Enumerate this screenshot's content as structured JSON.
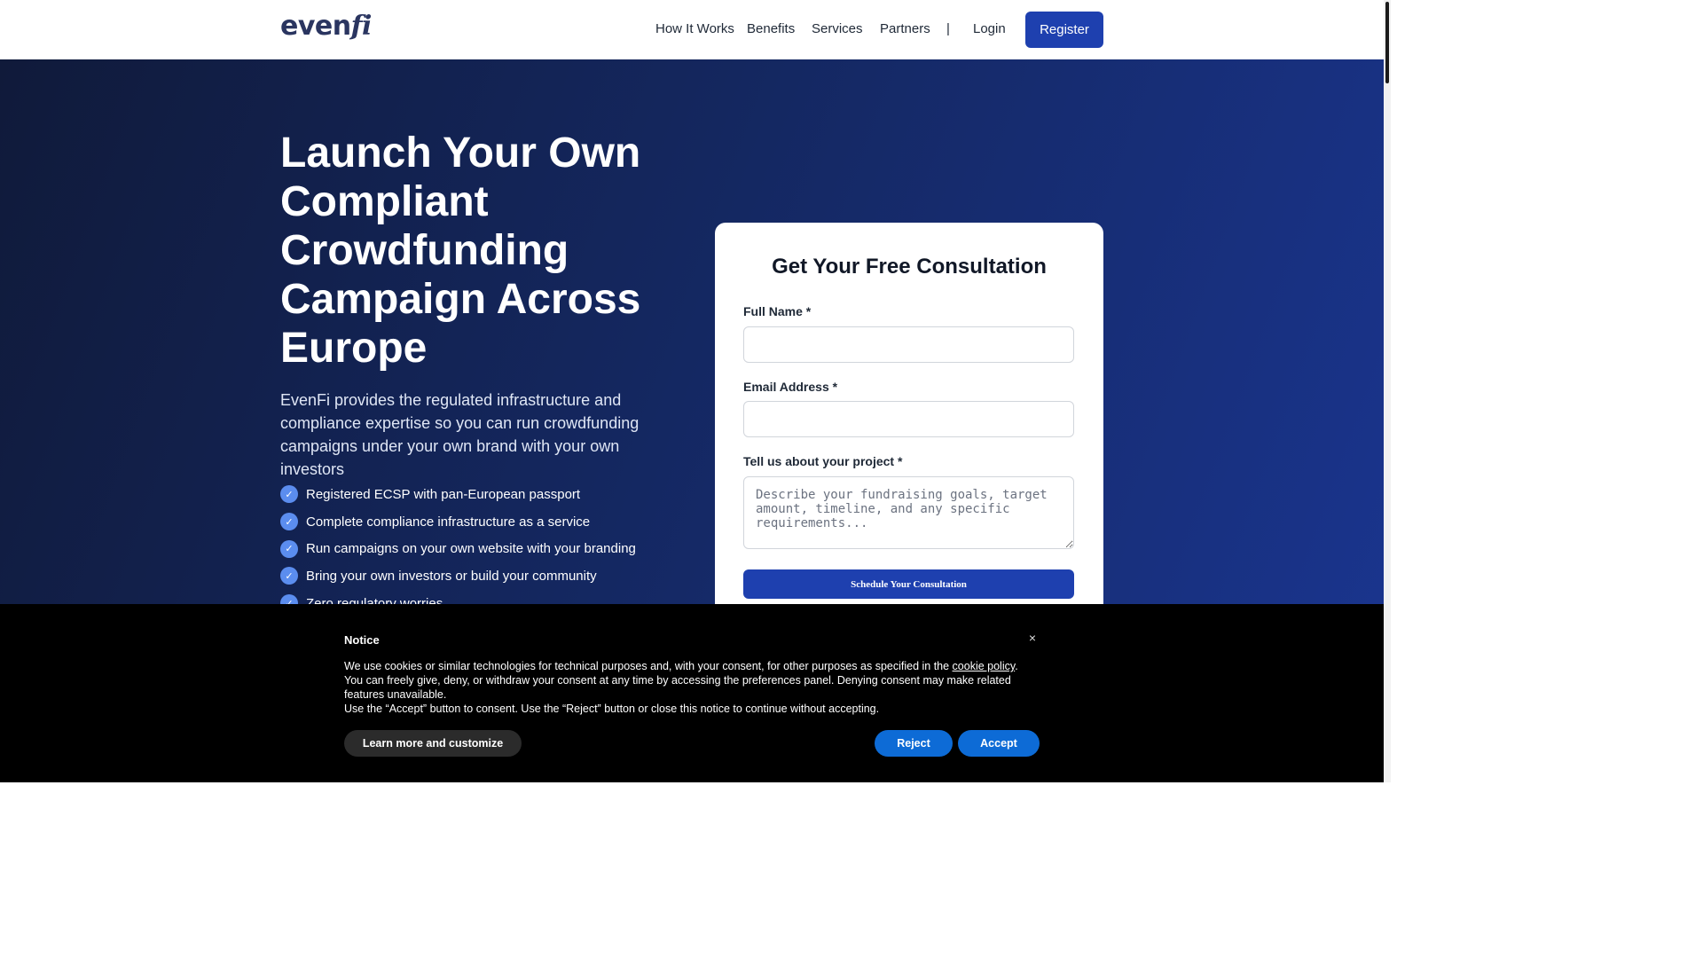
{
  "header": {
    "logo_main": "even",
    "logo_fi": "fi",
    "nav": {
      "how_it_works": "How It Works",
      "benefits": "Benefits",
      "services": "Services",
      "partners": "Partners",
      "divider": "|",
      "login": "Login",
      "register": "Register"
    }
  },
  "hero": {
    "title": "Launch Your Own Compliant Crowdfunding Campaign Across Europe",
    "subtitle": "EvenFi provides the regulated infrastructure and compliance expertise so you can run crowdfunding campaigns under your own brand with your own investors",
    "check_icon": "check-icon",
    "features": [
      "Registered ECSP with pan-European passport",
      "Complete compliance infrastructure as a service",
      "Run campaigns on your own website with your branding",
      "Bring your own investors or build your community",
      "Zero regulatory worries"
    ]
  },
  "form": {
    "title": "Get Your Free Consultation",
    "name_label": "Full Name *",
    "email_label": "Email Address *",
    "project_label": "Tell us about your project *",
    "project_placeholder": "Describe your fundraising goals, target amount, timeline, and any specific requirements...",
    "submit": "Schedule Your Consultation"
  },
  "cookie": {
    "title": "Notice",
    "close": "×",
    "line1_pre": "We use cookies or similar technologies for technical purposes and, with your consent, for other purposes as specified in the ",
    "line1_link": "cookie policy",
    "line1_post": ".",
    "line2": "You can freely give, deny, or withdraw your consent at any time by accessing the preferences panel. Denying consent may make related features unavailable.",
    "line3": "Use the “Accept” button to consent. Use the “Reject” button or close this notice to continue without accepting.",
    "learn_more": "Learn more and customize",
    "reject": "Reject",
    "accept": "Accept"
  },
  "colors": {
    "primary": "#1e40af",
    "cookie_button": "#0d6bd6",
    "check_badge": "#5b8def"
  }
}
